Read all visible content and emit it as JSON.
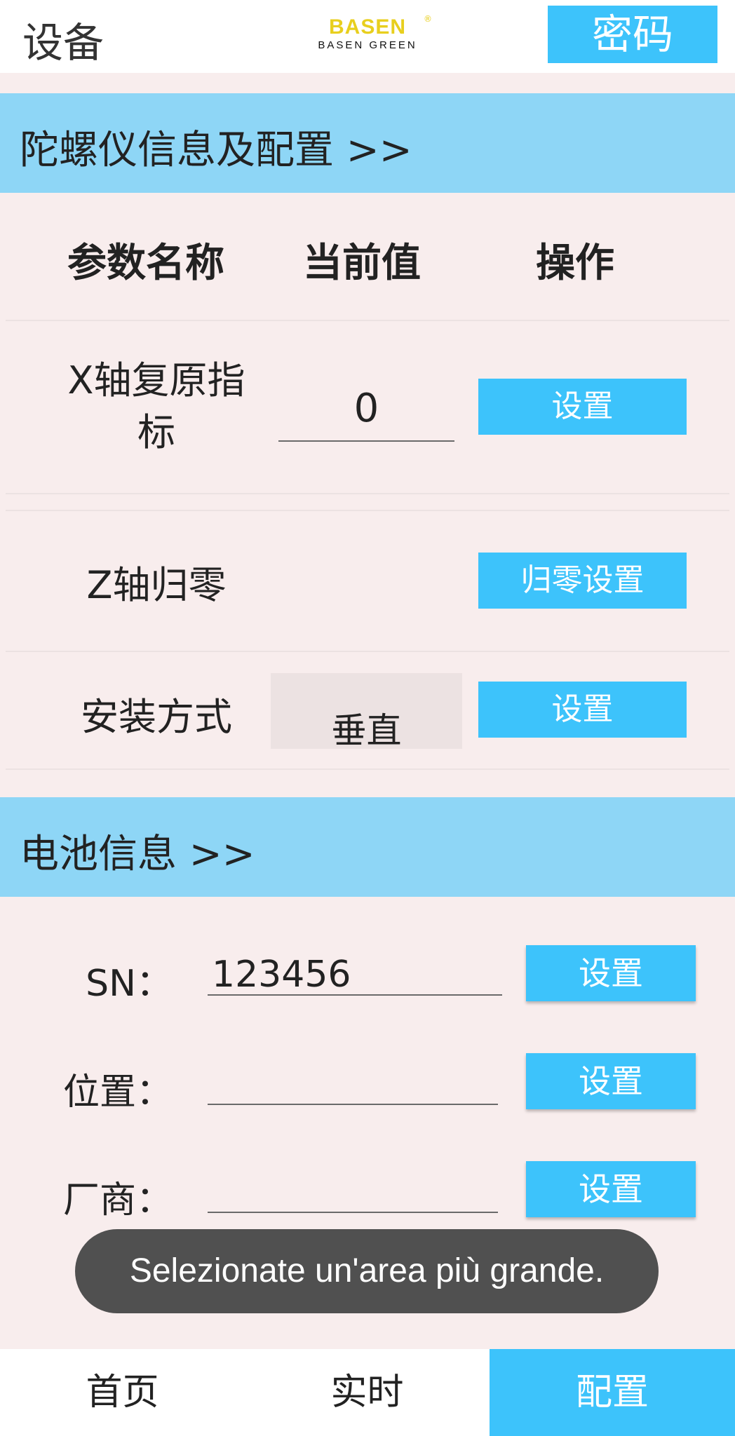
{
  "header": {
    "title": "设备",
    "logo_main": "BASEN",
    "logo_sub": "BASEN GREEN",
    "logo_reg": "®",
    "password_button": "密码"
  },
  "gyro_section": {
    "title": "陀螺仪信息及配置 >>",
    "columns": [
      "参数名称",
      "当前值",
      "操作"
    ],
    "rows": [
      {
        "name_line1": "X轴复原指",
        "name_line2": "标",
        "value": "0",
        "action": "设置"
      },
      {
        "name": "Z轴归零",
        "action": "归零设置"
      },
      {
        "name": "安装方式",
        "value": "垂直",
        "action": "设置"
      }
    ]
  },
  "battery_section": {
    "title": "电池信息 >>",
    "fields": [
      {
        "label": "SN：",
        "value": "123456",
        "action": "设置"
      },
      {
        "label": "位置：",
        "value": "",
        "action": "设置"
      },
      {
        "label": "厂商：",
        "value": "",
        "action": "设置"
      }
    ]
  },
  "toast": "Selezionate un'area più grande.",
  "bottom_nav": [
    "首页",
    "实时",
    "配置"
  ],
  "colors": {
    "accent": "#3dc3fb",
    "section_header": "#8ed6f6",
    "background": "#f8eded",
    "toast": "#505050"
  }
}
